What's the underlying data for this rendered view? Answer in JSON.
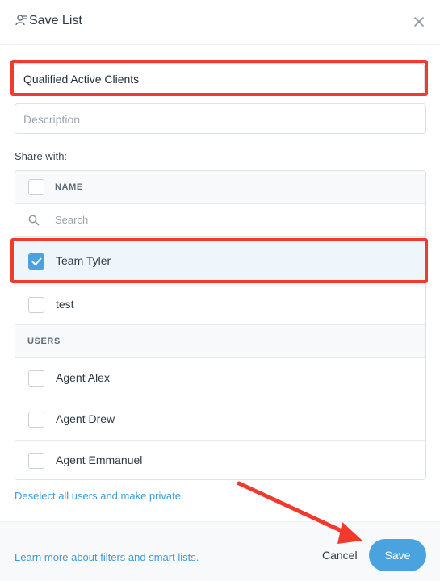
{
  "header": {
    "title": "Save List",
    "title_icon": "list-user-icon",
    "close_icon": "close-icon"
  },
  "form": {
    "name_value": "Qualified Active Clients",
    "description_placeholder": "Description",
    "share_label": "Share with:"
  },
  "share": {
    "column_header": "NAME",
    "search_placeholder": "Search",
    "groups": [
      {
        "label": "Team Tyler",
        "checked": true
      },
      {
        "label": "test",
        "checked": false
      }
    ],
    "users_header": "USERS",
    "users": [
      {
        "label": "Agent Alex",
        "checked": false
      },
      {
        "label": "Agent Drew",
        "checked": false
      },
      {
        "label": "Agent Emmanuel",
        "checked": false
      }
    ]
  },
  "links": {
    "deselect": "Deselect all users and make private",
    "learn_more": "Learn more about filters and smart lists."
  },
  "footer": {
    "cancel_label": "Cancel",
    "save_label": "Save"
  },
  "colors": {
    "accent": "#4aa3df",
    "link": "#3d9bd6",
    "annotation": "#f03a2e"
  }
}
